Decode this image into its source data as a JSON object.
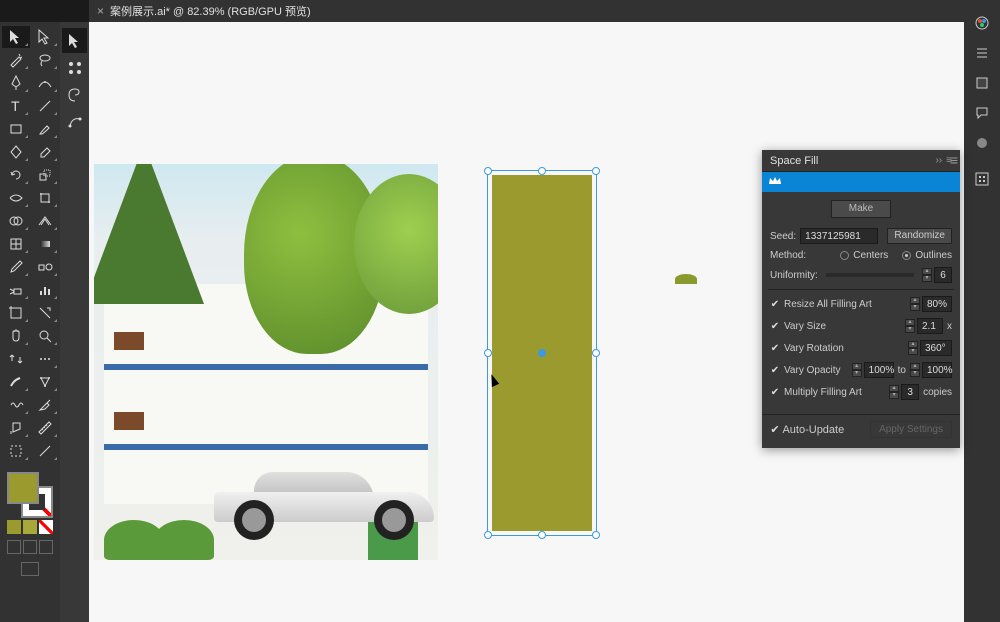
{
  "tab": {
    "title": "案例展示.ai* @ 82.39% (RGB/GPU 预览)"
  },
  "panel": {
    "title": "Space Fill",
    "make": "Make",
    "seed_label": "Seed:",
    "seed_value": "1337125981",
    "randomize": "Randomize",
    "method_label": "Method:",
    "method_centers": "Centers",
    "method_outlines": "Outlines",
    "uniformity_label": "Uniformity:",
    "uniformity_value": "6",
    "resize_label": "Resize All Filling Art",
    "resize_value": "80%",
    "vary_size_label": "Vary Size",
    "vary_size_value": "2.1",
    "vary_size_suffix": "x",
    "vary_rotation_label": "Vary Rotation",
    "vary_rotation_value": "360°",
    "vary_opacity_label": "Vary Opacity",
    "vary_opacity_from": "100%",
    "vary_opacity_to_label": "to",
    "vary_opacity_to": "100%",
    "multiply_label": "Multiply Filling Art",
    "multiply_value": "3",
    "multiply_suffix": "copies",
    "auto_update": "Auto-Update",
    "apply": "Apply Settings"
  },
  "colors": {
    "fill": "#9a9a2e"
  }
}
